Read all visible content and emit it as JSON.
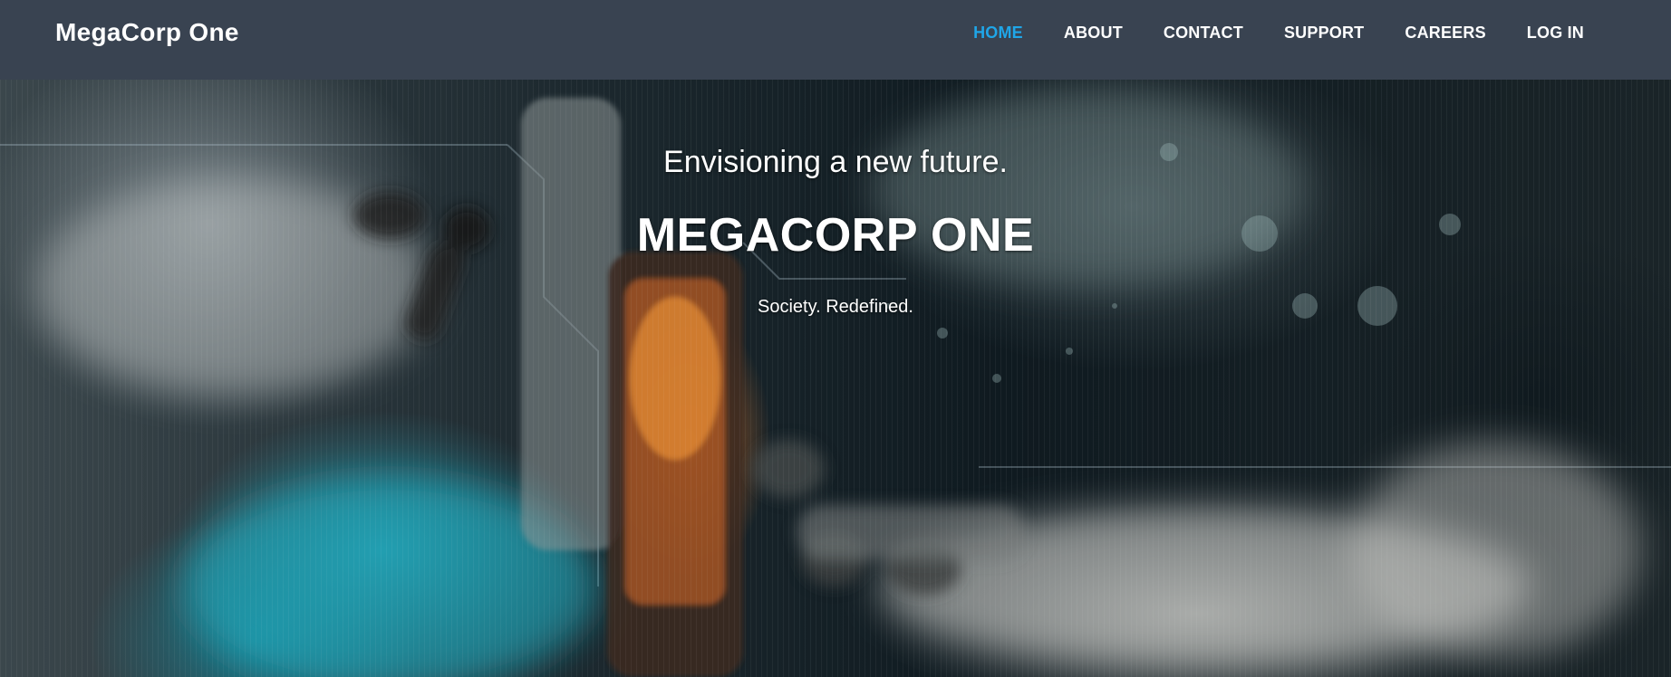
{
  "navbar": {
    "brand": "MegaCorp One",
    "items": [
      {
        "label": "HOME",
        "active": true
      },
      {
        "label": "ABOUT",
        "active": false
      },
      {
        "label": "CONTACT",
        "active": false
      },
      {
        "label": "SUPPORT",
        "active": false
      },
      {
        "label": "CAREERS",
        "active": false
      },
      {
        "label": "LOG IN",
        "active": false
      }
    ]
  },
  "hero": {
    "tagline": "Envisioning a new future.",
    "title": "MEGACORP ONE",
    "subline": "Society. Redefined."
  },
  "colors": {
    "navbar_bg": "#394351",
    "active_link": "#1fa6e8",
    "text": "#ffffff"
  }
}
